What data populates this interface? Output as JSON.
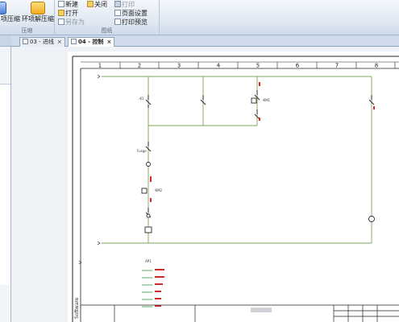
{
  "ribbon": {
    "compress_group": {
      "label": "压缩",
      "compress_button": "项压缩",
      "decompress_button": "环项解压缩"
    },
    "drawing_group": {
      "label": "图纸",
      "new": "新建",
      "close": "关闭",
      "open": "打开",
      "save_as": "另存为",
      "print": "打印",
      "page_setup": "页面设置",
      "print_preview": "打印预览"
    }
  },
  "tabs": [
    {
      "label": "03 - 进线",
      "close": "×"
    },
    {
      "label": "04 - 控制",
      "close": "×"
    }
  ],
  "sheet": {
    "column_numbers": [
      "1",
      "2",
      "3",
      "4",
      "5",
      "6",
      "7",
      "8"
    ],
    "side_text": "Software",
    "component_tags": {
      "k1": "-K1",
      "fuse": "Fusge",
      "km1": "-KM1",
      "km2": "-KM2",
      "ap1": "AP1"
    }
  },
  "colors": {
    "wire": "#7ea55a",
    "component": "#2a2a2a",
    "annotation_red": "#d22a2a",
    "annotation_green": "#2f9a3f",
    "ribbon_bg": "#dde6f1"
  }
}
